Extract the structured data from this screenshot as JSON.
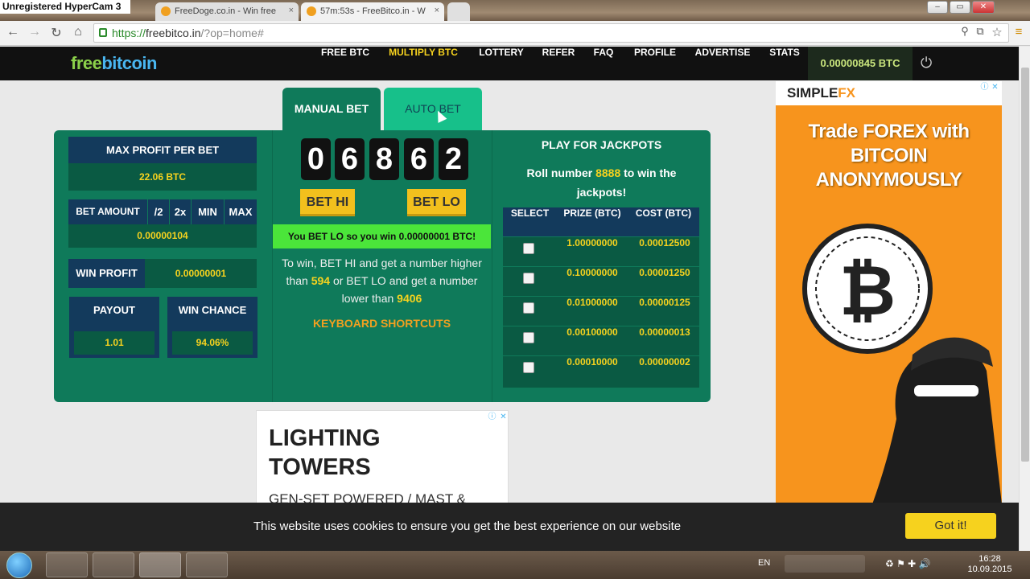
{
  "window": {
    "recorder_title": "Unregistered HyperCam 3"
  },
  "tabs": [
    {
      "label": "FreeDoge.co.in - Win free",
      "active": false
    },
    {
      "label": "57m:53s - FreeBitco.in - W",
      "active": true
    }
  ],
  "address": {
    "scheme": "https://",
    "host": "freebitco.in",
    "path": "/?op=home#"
  },
  "site": {
    "logo_a": "free",
    "logo_b": "bitcoin",
    "nav": [
      "FREE BTC",
      "MULTIPLY BTC",
      "LOTTERY",
      "REFER",
      "FAQ",
      "PROFILE",
      "ADVERTISE",
      "STATS"
    ],
    "balance": "0.00000845 BTC"
  },
  "bet": {
    "tab_manual": "MANUAL BET",
    "tab_auto": "AUTO BET",
    "max_profit_label": "MAX PROFIT PER BET",
    "max_profit_value": "22.06 BTC",
    "bet_amount_label": "BET AMOUNT",
    "bet_controls": [
      "/2",
      "2x",
      "MIN",
      "MAX"
    ],
    "bet_amount_value": "0.00000104",
    "win_profit_label": "WIN PROFIT",
    "win_profit_value": "0.00000001",
    "payout_label": "PAYOUT",
    "payout_value": "1.01",
    "win_chance_label": "WIN CHANCE",
    "win_chance_value": "94.06%",
    "digits": [
      "0",
      "6",
      "8",
      "6",
      "2"
    ],
    "bet_hi": "BET HI",
    "bet_lo": "BET LO",
    "result": "You BET LO so you win 0.00000001 BTC!",
    "rules_1": "To win, BET HI and get a number higher than",
    "rules_hi_num": "594",
    "rules_2": "or BET LO and get a number lower than",
    "rules_lo_num": "9406",
    "keyboard": "KEYBOARD SHORTCUTS"
  },
  "jackpot": {
    "title": "PLAY FOR JACKPOTS",
    "text_1": "Roll number",
    "number": "8888",
    "text_2": "to win the jackpots!",
    "headers": [
      "SELECT",
      "PRIZE (BTC)",
      "COST (BTC)"
    ],
    "rows": [
      {
        "prize": "1.00000000",
        "cost": "0.00012500"
      },
      {
        "prize": "0.10000000",
        "cost": "0.00001250"
      },
      {
        "prize": "0.01000000",
        "cost": "0.00000125"
      },
      {
        "prize": "0.00100000",
        "cost": "0.00000013"
      },
      {
        "prize": "0.00010000",
        "cost": "0.00000002"
      }
    ]
  },
  "ads": {
    "lighting_title": "LIGHTING TOWERS",
    "lighting_sub": "GEN-SET POWERED / MAST &",
    "fx_brand_a": "SIMPLE",
    "fx_brand_b": "FX",
    "fx_head": "Trade FOREX with BITCOIN ANONYMOUSLY"
  },
  "cookie": {
    "text": "This website uses cookies to ensure you get the best experience on our website",
    "button": "Got it!"
  },
  "taskbar": {
    "lang": "EN",
    "time": "16:28",
    "date": "10.09.2015"
  }
}
